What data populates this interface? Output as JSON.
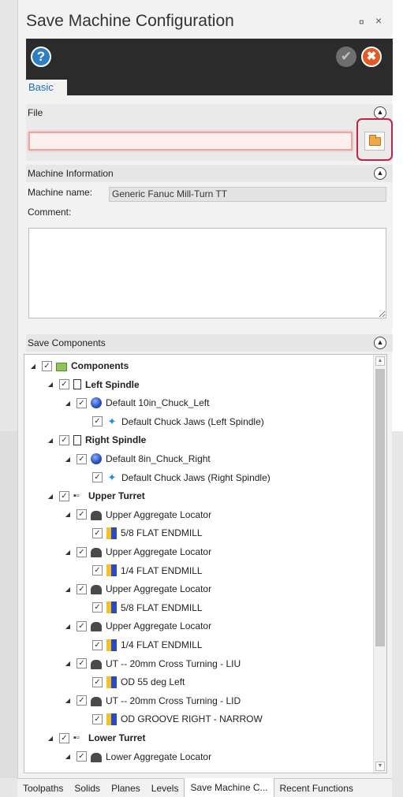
{
  "window": {
    "title": "Save Machine Configuration",
    "pin_glyph": "¤",
    "close_glyph": "×"
  },
  "toolbar": {
    "help_glyph": "?",
    "ok_glyph": "✔",
    "cancel_glyph": "✖"
  },
  "tabs": {
    "basic_label": "Basic"
  },
  "file_section": {
    "header": "File",
    "file_value": "",
    "browse_icon": "folder-icon"
  },
  "machine_info": {
    "header": "Machine Information",
    "name_label": "Machine name:",
    "name_value": "Generic Fanuc Mill-Turn TT",
    "comment_label": "Comment:",
    "comment_value": ""
  },
  "components_section": {
    "header": "Save Components",
    "tree": [
      {
        "label": "Components",
        "bold": true,
        "icon": "folder-icon",
        "level": 0,
        "expander": "◢",
        "checked": true
      },
      {
        "label": "Left Spindle",
        "bold": true,
        "icon": "spindle-icon",
        "level": 1,
        "expander": "◢",
        "checked": true
      },
      {
        "label": "Default 10in_Chuck_Left",
        "bold": false,
        "icon": "chuck-icon",
        "level": 2,
        "expander": "◢",
        "checked": true
      },
      {
        "label": "Default Chuck Jaws (Left Spindle)",
        "bold": false,
        "icon": "jaws-icon",
        "level": 3,
        "expander": "",
        "checked": true
      },
      {
        "label": "Right Spindle",
        "bold": true,
        "icon": "spindle-icon",
        "level": 1,
        "expander": "◢",
        "checked": true
      },
      {
        "label": "Default 8in_Chuck_Right",
        "bold": false,
        "icon": "chuck-icon",
        "level": 2,
        "expander": "◢",
        "checked": true
      },
      {
        "label": "Default Chuck Jaws (Right Spindle)",
        "bold": false,
        "icon": "jaws-icon",
        "level": 3,
        "expander": "",
        "checked": true
      },
      {
        "label": "Upper Turret",
        "bold": true,
        "icon": "turret-icon",
        "level": 1,
        "expander": "◢",
        "checked": true
      },
      {
        "label": "Upper Aggregate Locator",
        "bold": false,
        "icon": "locator-icon",
        "level": 2,
        "expander": "◢",
        "checked": true
      },
      {
        "label": "5/8 FLAT ENDMILL",
        "bold": false,
        "icon": "tool-icon",
        "level": 3,
        "expander": "",
        "checked": true
      },
      {
        "label": "Upper Aggregate Locator",
        "bold": false,
        "icon": "locator-icon",
        "level": 2,
        "expander": "◢",
        "checked": true
      },
      {
        "label": "1/4 FLAT ENDMILL",
        "bold": false,
        "icon": "tool-icon",
        "level": 3,
        "expander": "",
        "checked": true
      },
      {
        "label": "Upper Aggregate Locator",
        "bold": false,
        "icon": "locator-icon",
        "level": 2,
        "expander": "◢",
        "checked": true
      },
      {
        "label": "5/8 FLAT ENDMILL",
        "bold": false,
        "icon": "tool-icon",
        "level": 3,
        "expander": "",
        "checked": true
      },
      {
        "label": "Upper Aggregate Locator",
        "bold": false,
        "icon": "locator-icon",
        "level": 2,
        "expander": "◢",
        "checked": true
      },
      {
        "label": "1/4 FLAT ENDMILL",
        "bold": false,
        "icon": "tool-icon",
        "level": 3,
        "expander": "",
        "checked": true
      },
      {
        "label": "UT -- 20mm Cross Turning - LIU",
        "bold": false,
        "icon": "locator-icon",
        "level": 2,
        "expander": "◢",
        "checked": true
      },
      {
        "label": "OD 55 deg Left",
        "bold": false,
        "icon": "tool-icon",
        "level": 3,
        "expander": "",
        "checked": true
      },
      {
        "label": "UT -- 20mm Cross Turning - LID",
        "bold": false,
        "icon": "locator-icon",
        "level": 2,
        "expander": "◢",
        "checked": true
      },
      {
        "label": "OD GROOVE RIGHT - NARROW",
        "bold": false,
        "icon": "tool-icon",
        "level": 3,
        "expander": "",
        "checked": true
      },
      {
        "label": "Lower Turret",
        "bold": true,
        "icon": "turret-icon",
        "level": 1,
        "expander": "◢",
        "checked": true
      },
      {
        "label": "Lower Aggregate Locator",
        "bold": false,
        "icon": "locator-icon",
        "level": 2,
        "expander": "◢",
        "checked": true
      }
    ]
  },
  "bottom_tabs": [
    {
      "label": "Toolpaths",
      "active": false
    },
    {
      "label": "Solids",
      "active": false
    },
    {
      "label": "Planes",
      "active": false
    },
    {
      "label": "Levels",
      "active": false
    },
    {
      "label": "Save Machine C...",
      "active": true
    },
    {
      "label": "Recent Functions",
      "active": false
    }
  ],
  "colors": {
    "accent_blue": "#1f6fb7",
    "error_highlight": "#c4224b",
    "dark_toolbar": "#2b2b2b",
    "cancel_orange": "#e05a25"
  }
}
